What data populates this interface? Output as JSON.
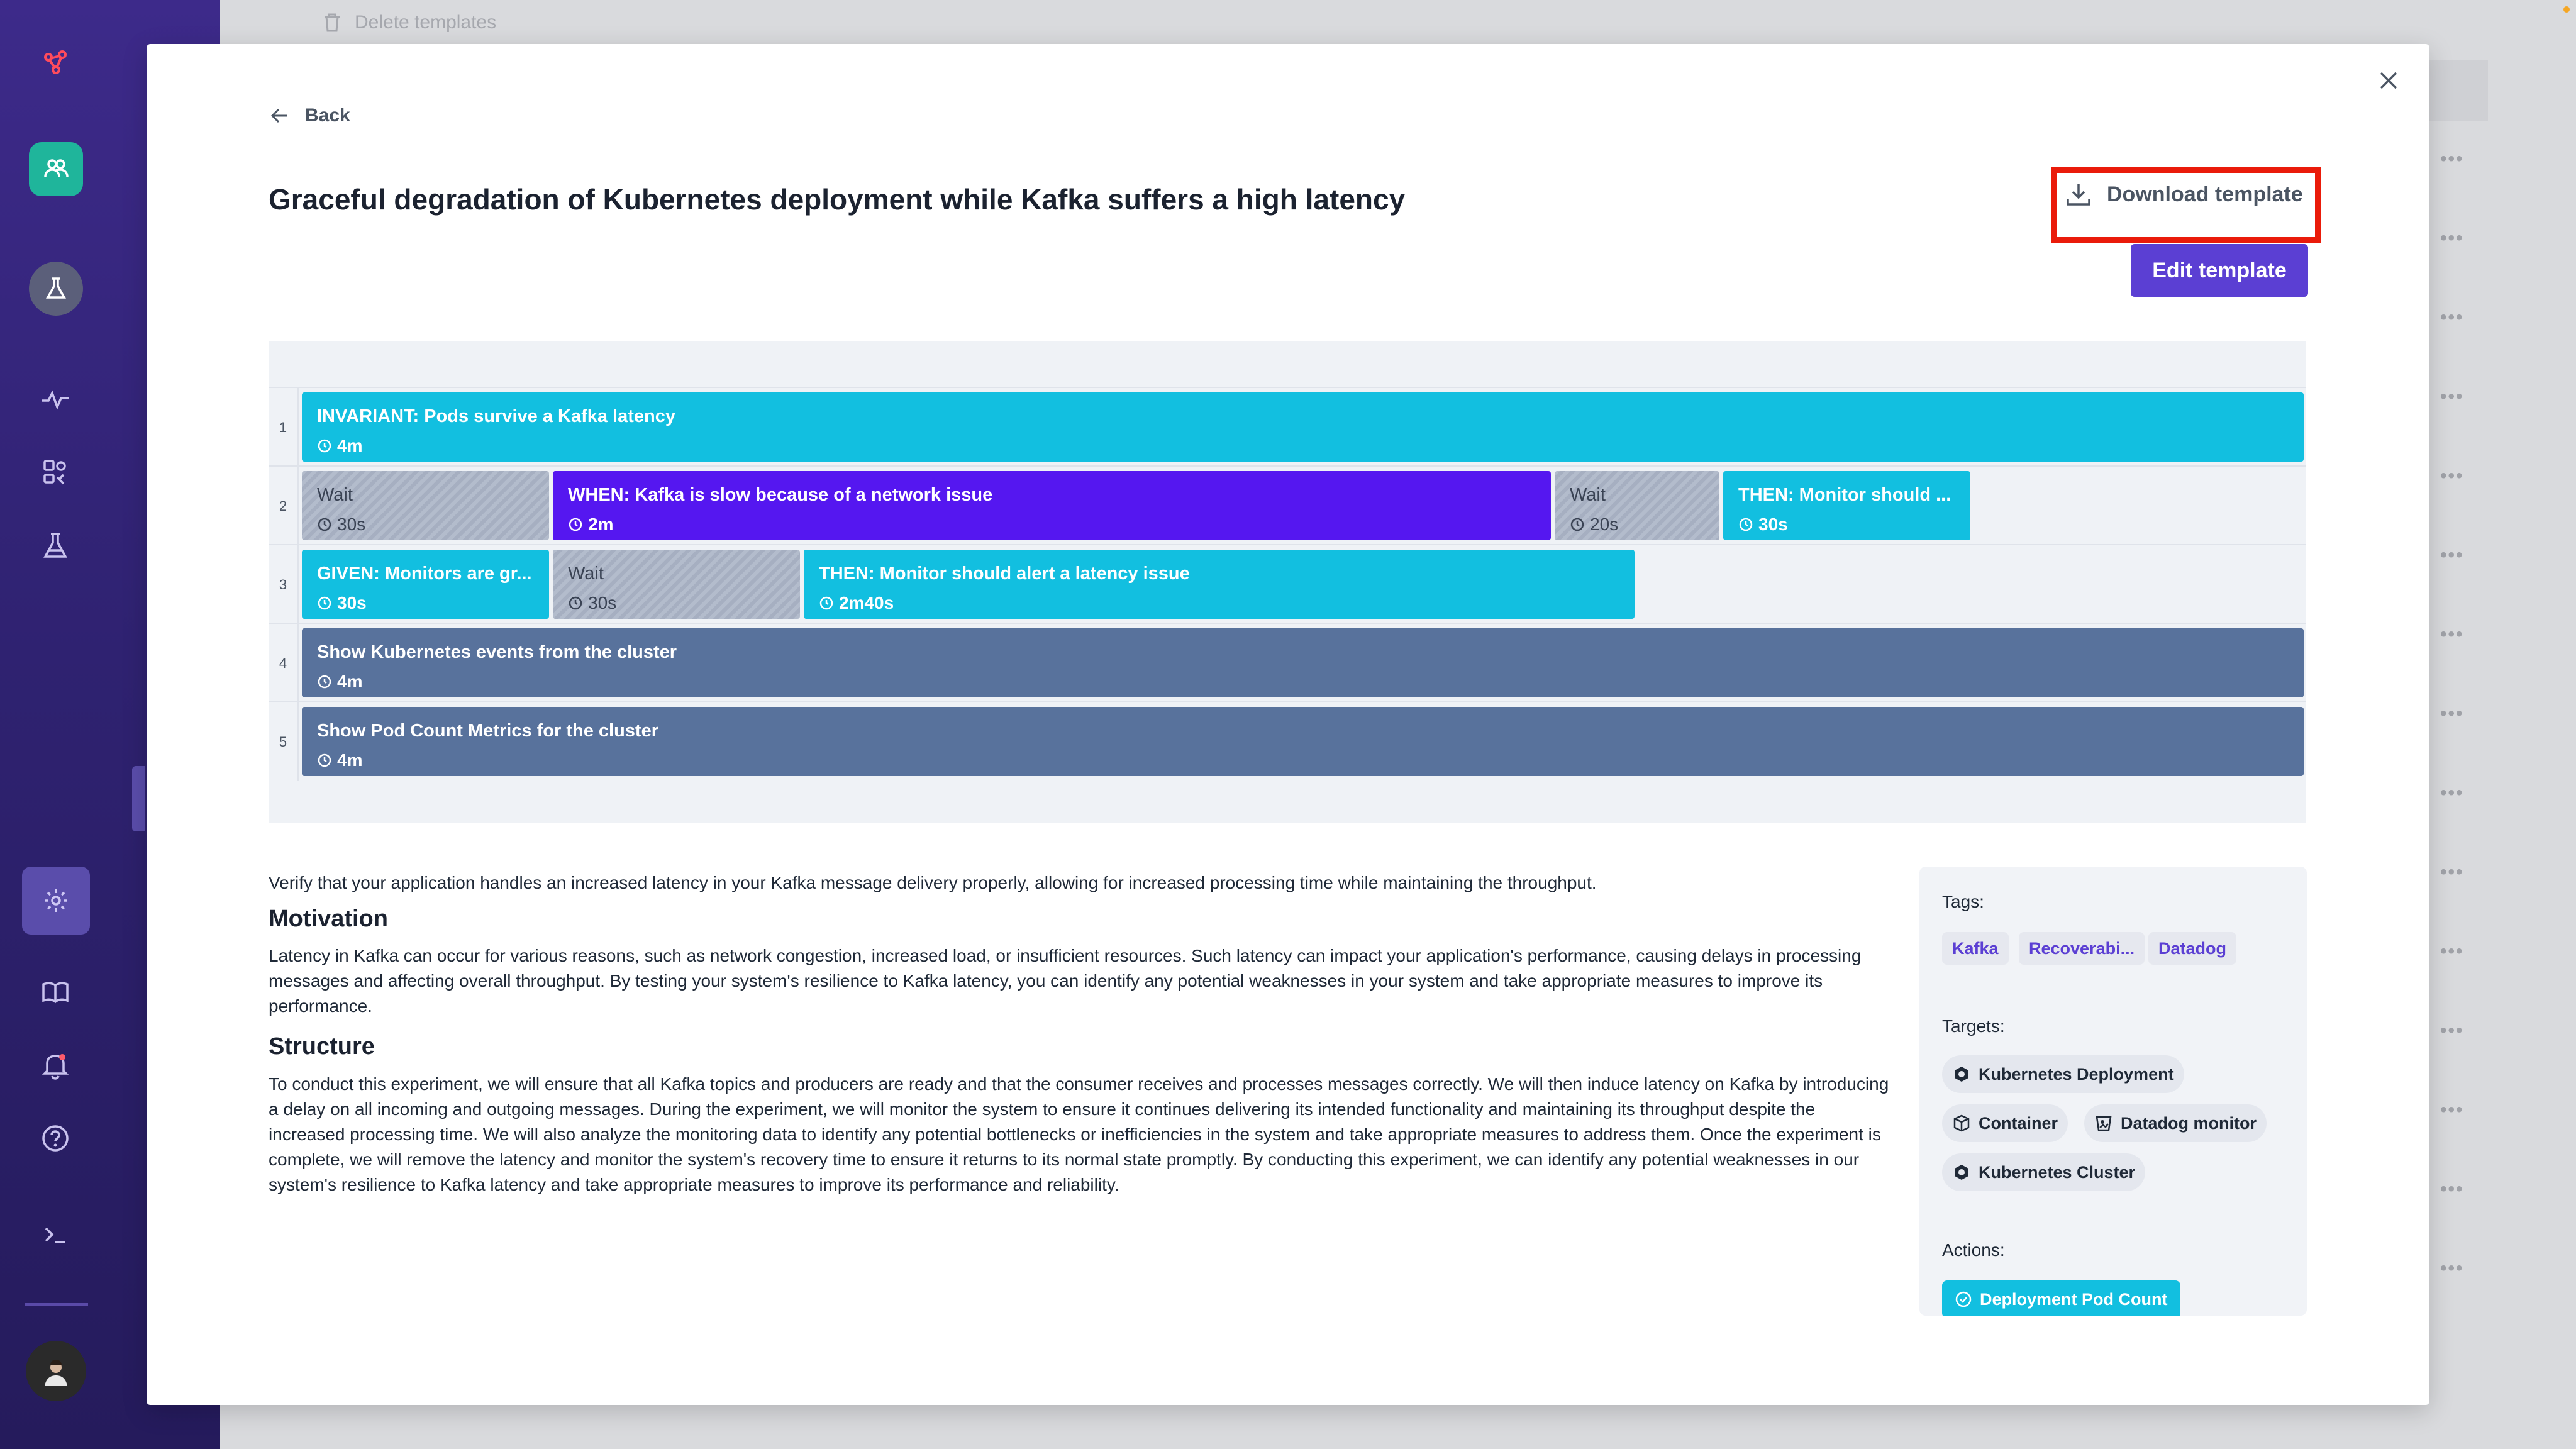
{
  "background": {
    "delete_templates": "Delete templates",
    "row_menu": "•••"
  },
  "modal": {
    "back": "Back",
    "title": "Graceful degradation of Kubernetes deployment while Kafka suffers a high latency",
    "download": "Download template",
    "edit": "Edit template"
  },
  "timeline": {
    "lanes": [
      {
        "num": "1",
        "blocks": [
          {
            "title": "INVARIANT: Pods survive a Kafka latency",
            "dur": "4m",
            "kind": "cyan"
          }
        ]
      },
      {
        "num": "2",
        "blocks": [
          {
            "title": "Wait",
            "dur": "30s",
            "kind": "wait"
          },
          {
            "title": "WHEN: Kafka is slow because of a network issue",
            "dur": "2m",
            "kind": "purple"
          },
          {
            "title": "Wait",
            "dur": "20s",
            "kind": "wait"
          },
          {
            "title": "THEN: Monitor should ...",
            "dur": "30s",
            "kind": "cyan"
          }
        ]
      },
      {
        "num": "3",
        "blocks": [
          {
            "title": "GIVEN: Monitors are gr...",
            "dur": "30s",
            "kind": "cyan"
          },
          {
            "title": "Wait",
            "dur": "30s",
            "kind": "wait"
          },
          {
            "title": "THEN: Monitor should alert a latency issue",
            "dur": "2m40s",
            "kind": "cyan"
          }
        ]
      },
      {
        "num": "4",
        "blocks": [
          {
            "title": "Show Kubernetes events from the cluster",
            "dur": "4m",
            "kind": "slate"
          }
        ]
      },
      {
        "num": "5",
        "blocks": [
          {
            "title": "Show Pod Count Metrics for the cluster",
            "dur": "4m",
            "kind": "slate"
          }
        ]
      }
    ]
  },
  "description": {
    "intro": "Verify that your application handles an increased latency in your Kafka message delivery properly, allowing for increased processing time while maintaining the throughput.",
    "motivation_heading": "Motivation",
    "motivation": "Latency in Kafka can occur for various reasons, such as network congestion, increased load, or insufficient resources. Such latency can impact your application's performance, causing delays in processing messages and affecting overall throughput. By testing your system's resilience to Kafka latency, you can identify any potential weaknesses in your system and take appropriate measures to improve its performance.",
    "structure_heading": "Structure",
    "structure": "To conduct this experiment, we will ensure that all Kafka topics and producers are ready and that the consumer receives and processes messages correctly. We will then induce latency on Kafka by introducing a delay on all incoming and outgoing messages. During the experiment, we will monitor the system to ensure it continues delivering its intended functionality and maintaining its throughput despite the increased processing time. We will also analyze the monitoring data to identify any potential bottlenecks or inefficiencies in the system and take appropriate measures to address them. Once the experiment is complete, we will remove the latency and monitor the system's recovery time to ensure it returns to its normal state promptly. By conducting this experiment, we can identify any potential weaknesses in our system's resilience to Kafka latency and take appropriate measures to improve its performance and reliability."
  },
  "panel": {
    "tags_label": "Tags:",
    "tags": [
      "Kafka",
      "Recoverabi...",
      "Datadog"
    ],
    "targets_label": "Targets:",
    "targets": [
      "Kubernetes Deployment",
      "Container",
      "Datadog monitor",
      "Kubernetes Cluster"
    ],
    "actions_label": "Actions:",
    "actions": [
      "Deployment Pod Count"
    ]
  },
  "colors": {
    "accent": "#5b3fd3",
    "cyan": "#12bfe0",
    "purple": "#5517f0",
    "slate": "#58729c",
    "highlight": "#ea1b0a"
  }
}
